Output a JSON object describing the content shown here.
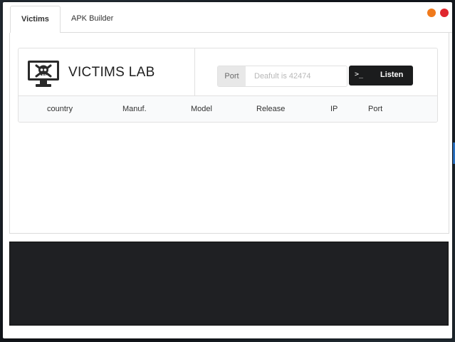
{
  "tabs": [
    {
      "label": "Victims",
      "active": true
    },
    {
      "label": "APK Builder",
      "active": false
    }
  ],
  "window_controls": {
    "minimize_color": "#f07a1c",
    "close_color": "#e0262e"
  },
  "lab": {
    "title": "VICTIMS LAB",
    "icon": "monitor-skull-icon"
  },
  "listen_form": {
    "port_label": "Port",
    "port_placeholder": "Deafult is 42474",
    "port_value": "",
    "listen_icon": ">_",
    "listen_label": "Listen"
  },
  "table": {
    "columns": [
      "country",
      "Manuf.",
      "Model",
      "Release",
      "IP",
      "Port"
    ],
    "rows": []
  },
  "console": {
    "text": ""
  }
}
